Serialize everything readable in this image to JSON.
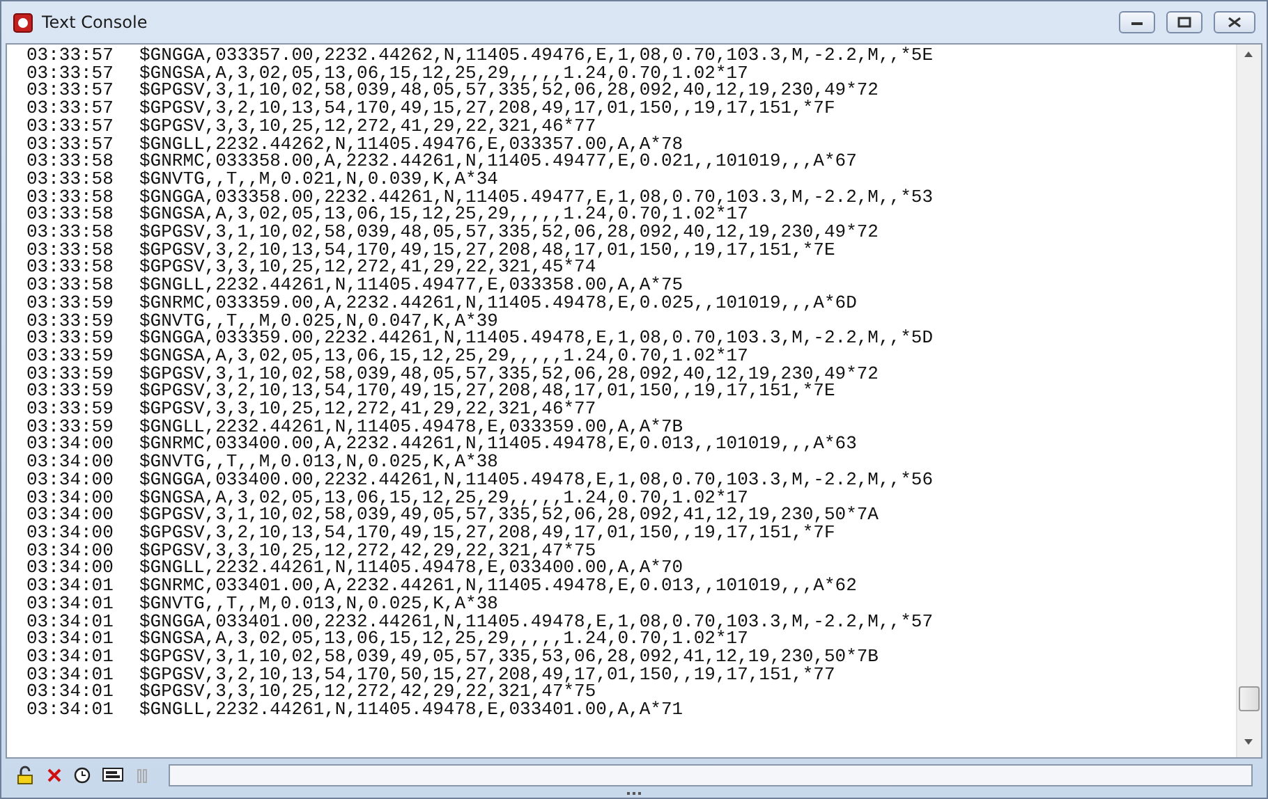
{
  "window": {
    "title": "Text Console"
  },
  "lines": [
    {
      "time": "03:33:57",
      "message": "$GNGGA,033357.00,2232.44262,N,11405.49476,E,1,08,0.70,103.3,M,-2.2,M,,*5E"
    },
    {
      "time": "03:33:57",
      "message": "$GNGSA,A,3,02,05,13,06,15,12,25,29,,,,,1.24,0.70,1.02*17"
    },
    {
      "time": "03:33:57",
      "message": "$GPGSV,3,1,10,02,58,039,48,05,57,335,52,06,28,092,40,12,19,230,49*72"
    },
    {
      "time": "03:33:57",
      "message": "$GPGSV,3,2,10,13,54,170,49,15,27,208,49,17,01,150,,19,17,151,*7F"
    },
    {
      "time": "03:33:57",
      "message": "$GPGSV,3,3,10,25,12,272,41,29,22,321,46*77"
    },
    {
      "time": "03:33:57",
      "message": "$GNGLL,2232.44262,N,11405.49476,E,033357.00,A,A*78"
    },
    {
      "time": "03:33:58",
      "message": "$GNRMC,033358.00,A,2232.44261,N,11405.49477,E,0.021,,101019,,,A*67"
    },
    {
      "time": "03:33:58",
      "message": "$GNVTG,,T,,M,0.021,N,0.039,K,A*34"
    },
    {
      "time": "03:33:58",
      "message": "$GNGGA,033358.00,2232.44261,N,11405.49477,E,1,08,0.70,103.3,M,-2.2,M,,*53"
    },
    {
      "time": "03:33:58",
      "message": "$GNGSA,A,3,02,05,13,06,15,12,25,29,,,,,1.24,0.70,1.02*17"
    },
    {
      "time": "03:33:58",
      "message": "$GPGSV,3,1,10,02,58,039,48,05,57,335,52,06,28,092,40,12,19,230,49*72"
    },
    {
      "time": "03:33:58",
      "message": "$GPGSV,3,2,10,13,54,170,49,15,27,208,48,17,01,150,,19,17,151,*7E"
    },
    {
      "time": "03:33:58",
      "message": "$GPGSV,3,3,10,25,12,272,41,29,22,321,45*74"
    },
    {
      "time": "03:33:58",
      "message": "$GNGLL,2232.44261,N,11405.49477,E,033358.00,A,A*75"
    },
    {
      "time": "03:33:59",
      "message": "$GNRMC,033359.00,A,2232.44261,N,11405.49478,E,0.025,,101019,,,A*6D"
    },
    {
      "time": "03:33:59",
      "message": "$GNVTG,,T,,M,0.025,N,0.047,K,A*39"
    },
    {
      "time": "03:33:59",
      "message": "$GNGGA,033359.00,2232.44261,N,11405.49478,E,1,08,0.70,103.3,M,-2.2,M,,*5D"
    },
    {
      "time": "03:33:59",
      "message": "$GNGSA,A,3,02,05,13,06,15,12,25,29,,,,,1.24,0.70,1.02*17"
    },
    {
      "time": "03:33:59",
      "message": "$GPGSV,3,1,10,02,58,039,48,05,57,335,52,06,28,092,40,12,19,230,49*72"
    },
    {
      "time": "03:33:59",
      "message": "$GPGSV,3,2,10,13,54,170,49,15,27,208,48,17,01,150,,19,17,151,*7E"
    },
    {
      "time": "03:33:59",
      "message": "$GPGSV,3,3,10,25,12,272,41,29,22,321,46*77"
    },
    {
      "time": "03:33:59",
      "message": "$GNGLL,2232.44261,N,11405.49478,E,033359.00,A,A*7B"
    },
    {
      "time": "03:34:00",
      "message": "$GNRMC,033400.00,A,2232.44261,N,11405.49478,E,0.013,,101019,,,A*63"
    },
    {
      "time": "03:34:00",
      "message": "$GNVTG,,T,,M,0.013,N,0.025,K,A*38"
    },
    {
      "time": "03:34:00",
      "message": "$GNGGA,033400.00,2232.44261,N,11405.49478,E,1,08,0.70,103.3,M,-2.2,M,,*56"
    },
    {
      "time": "03:34:00",
      "message": "$GNGSA,A,3,02,05,13,06,15,12,25,29,,,,,1.24,0.70,1.02*17"
    },
    {
      "time": "03:34:00",
      "message": "$GPGSV,3,1,10,02,58,039,49,05,57,335,52,06,28,092,41,12,19,230,50*7A"
    },
    {
      "time": "03:34:00",
      "message": "$GPGSV,3,2,10,13,54,170,49,15,27,208,49,17,01,150,,19,17,151,*7F"
    },
    {
      "time": "03:34:00",
      "message": "$GPGSV,3,3,10,25,12,272,42,29,22,321,47*75"
    },
    {
      "time": "03:34:00",
      "message": "$GNGLL,2232.44261,N,11405.49478,E,033400.00,A,A*70"
    },
    {
      "time": "03:34:01",
      "message": "$GNRMC,033401.00,A,2232.44261,N,11405.49478,E,0.013,,101019,,,A*62"
    },
    {
      "time": "03:34:01",
      "message": "$GNVTG,,T,,M,0.013,N,0.025,K,A*38"
    },
    {
      "time": "03:34:01",
      "message": "$GNGGA,033401.00,2232.44261,N,11405.49478,E,1,08,0.70,103.3,M,-2.2,M,,*57"
    },
    {
      "time": "03:34:01",
      "message": "$GNGSA,A,3,02,05,13,06,15,12,25,29,,,,,1.24,0.70,1.02*17"
    },
    {
      "time": "03:34:01",
      "message": "$GPGSV,3,1,10,02,58,039,49,05,57,335,53,06,28,092,41,12,19,230,50*7B"
    },
    {
      "time": "03:34:01",
      "message": "$GPGSV,3,2,10,13,54,170,50,15,27,208,49,17,01,150,,19,17,151,*77"
    },
    {
      "time": "03:34:01",
      "message": "$GPGSV,3,3,10,25,12,272,42,29,22,321,47*75"
    },
    {
      "time": "03:34:01",
      "message": "$GNGLL,2232.44261,N,11405.49478,E,033401.00,A,A*71"
    }
  ]
}
